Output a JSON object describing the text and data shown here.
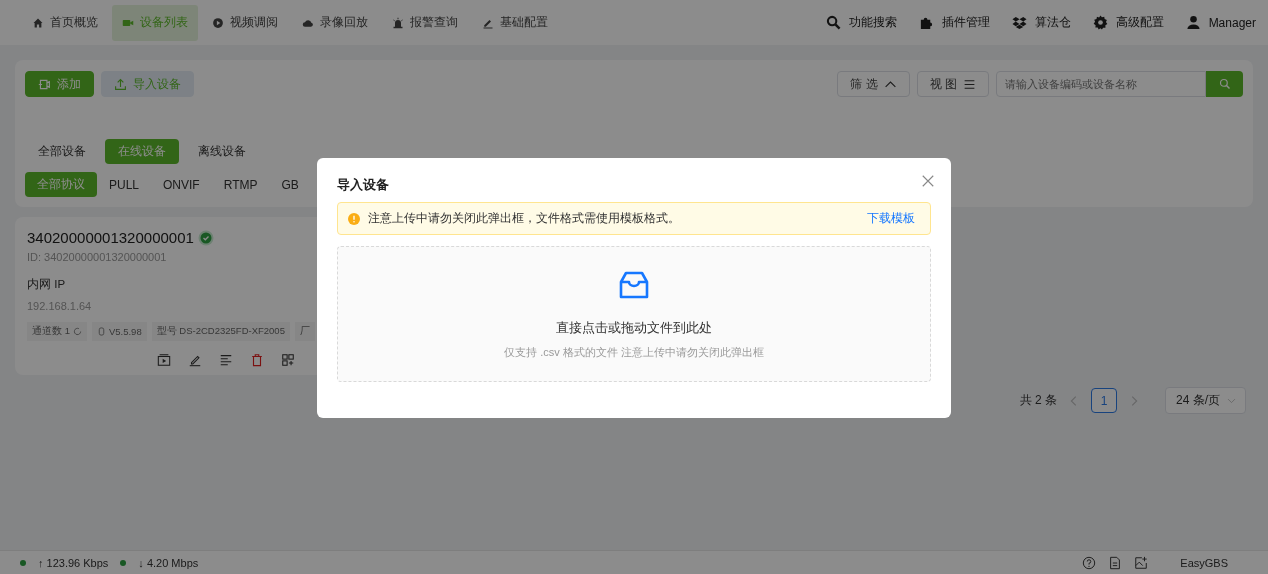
{
  "nav": {
    "items": [
      {
        "label": "首页概览",
        "selected": false
      },
      {
        "label": "设备列表",
        "selected": true
      },
      {
        "label": "视频调阅",
        "selected": false
      },
      {
        "label": "录像回放",
        "selected": false
      },
      {
        "label": "报警查询",
        "selected": false
      },
      {
        "label": "基础配置",
        "selected": false
      }
    ],
    "right_items": [
      {
        "label": "功能搜索"
      },
      {
        "label": "插件管理"
      },
      {
        "label": "算法仓"
      },
      {
        "label": "高级配置"
      },
      {
        "label": "Manager"
      }
    ]
  },
  "toolbar": {
    "add_button": "添加",
    "import_button": "导入设备",
    "filter_button": "筛 选",
    "view_button": "视 图",
    "search": {
      "placeholder": "请输入设备编码或设备名称"
    }
  },
  "status_tabs": [
    {
      "label": "全部设备",
      "selected": false
    },
    {
      "label": "在线设备",
      "selected": true
    },
    {
      "label": "离线设备",
      "selected": false
    }
  ],
  "protocol_tabs": [
    {
      "label": "全部协议",
      "selected": true
    },
    {
      "label": "PULL",
      "selected": false
    },
    {
      "label": "ONVIF",
      "selected": false
    },
    {
      "label": "RTMP",
      "selected": false
    },
    {
      "label": "GB",
      "selected": false
    }
  ],
  "device_card": {
    "title": "34020000001320000001",
    "online": true,
    "id_line": "ID: 34020000001320000001",
    "ip_label": "内网 IP",
    "ip": "192.168.1.64",
    "tags": [
      "通道数 1",
      "V5.5.98",
      "型号 DS-2CD2325FD-XF2005",
      "厂"
    ]
  },
  "pagination": {
    "total": "共 2 条",
    "pages": [
      {
        "label": "1",
        "selected": true
      }
    ],
    "page_size": "24 条/页"
  },
  "status_bar": {
    "upload": "↑ 123.96 Kbps",
    "download": "↓ 4.20 Mbps",
    "brand": "EasyGBS"
  },
  "dialog": {
    "title": "导入设备",
    "alert": "注意上传中请勿关闭此弹出框，文件格式需使用模板格式。",
    "alert_link": "下载模板",
    "drop_title": "直接点击或拖动文件到此处",
    "drop_hint": "仅支持 .csv 格式的文件 注意上传中请勿关闭此弹出框"
  }
}
